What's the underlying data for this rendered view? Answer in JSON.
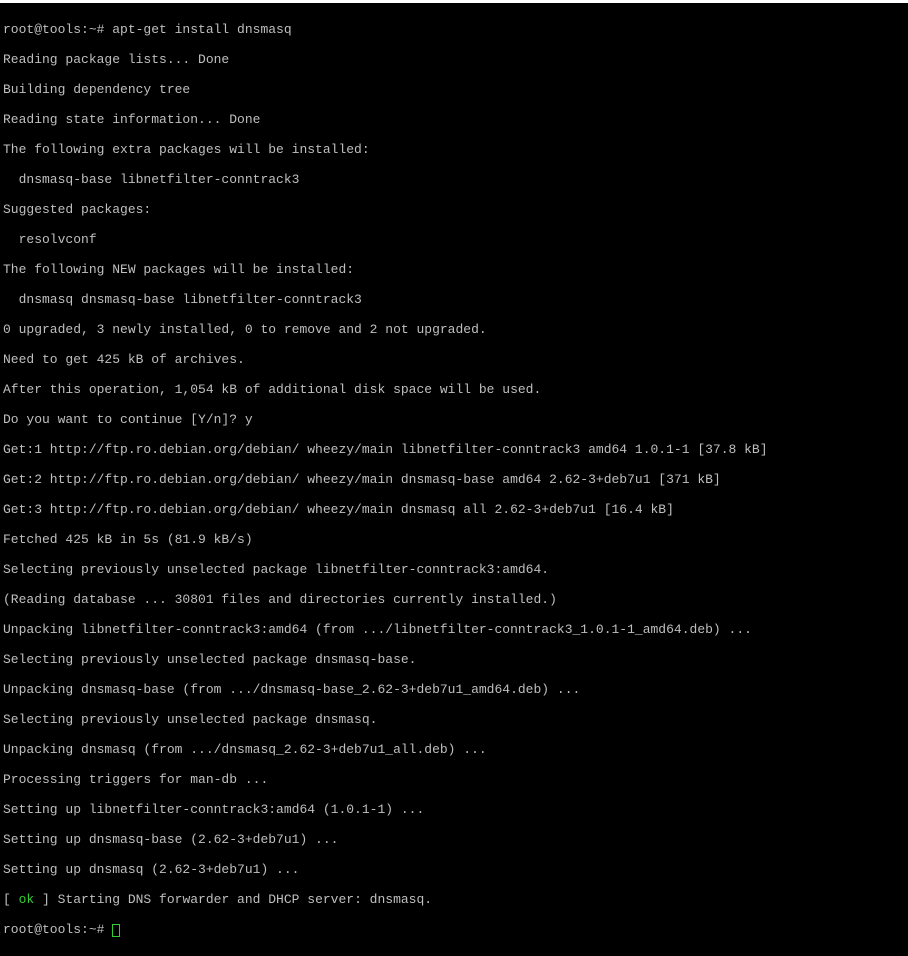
{
  "prompt1": {
    "user_host": "root@tools:~# ",
    "command": "apt-get install dnsmasq"
  },
  "lines": {
    "l1": "Reading package lists... Done",
    "l2": "Building dependency tree",
    "l3": "Reading state information... Done",
    "l4": "The following extra packages will be installed:",
    "l5": "  dnsmasq-base libnetfilter-conntrack3",
    "l6": "Suggested packages:",
    "l7": "  resolvconf",
    "l8": "The following NEW packages will be installed:",
    "l9": "  dnsmasq dnsmasq-base libnetfilter-conntrack3",
    "l10": "0 upgraded, 3 newly installed, 0 to remove and 2 not upgraded.",
    "l11": "Need to get 425 kB of archives.",
    "l12": "After this operation, 1,054 kB of additional disk space will be used.",
    "l13": "Do you want to continue [Y/n]? y",
    "l14": "Get:1 http://ftp.ro.debian.org/debian/ wheezy/main libnetfilter-conntrack3 amd64 1.0.1-1 [37.8 kB]",
    "l15": "Get:2 http://ftp.ro.debian.org/debian/ wheezy/main dnsmasq-base amd64 2.62-3+deb7u1 [371 kB]",
    "l16": "Get:3 http://ftp.ro.debian.org/debian/ wheezy/main dnsmasq all 2.62-3+deb7u1 [16.4 kB]",
    "l17": "Fetched 425 kB in 5s (81.9 kB/s)",
    "l18": "Selecting previously unselected package libnetfilter-conntrack3:amd64.",
    "l19": "(Reading database ... 30801 files and directories currently installed.)",
    "l20": "Unpacking libnetfilter-conntrack3:amd64 (from .../libnetfilter-conntrack3_1.0.1-1_amd64.deb) ...",
    "l21": "Selecting previously unselected package dnsmasq-base.",
    "l22": "Unpacking dnsmasq-base (from .../dnsmasq-base_2.62-3+deb7u1_amd64.deb) ...",
    "l23": "Selecting previously unselected package dnsmasq.",
    "l24": "Unpacking dnsmasq (from .../dnsmasq_2.62-3+deb7u1_all.deb) ...",
    "l25": "Processing triggers for man-db ...",
    "l26": "Setting up libnetfilter-conntrack3:amd64 (1.0.1-1) ...",
    "l27": "Setting up dnsmasq-base (2.62-3+deb7u1) ...",
    "l28": "Setting up dnsmasq (2.62-3+deb7u1) ..."
  },
  "status": {
    "pre": "[ ",
    "ok": "ok",
    "post": " ] Starting DNS forwarder and DHCP server: dnsmasq."
  },
  "prompt2": {
    "user_host": "root@tools:~# "
  }
}
